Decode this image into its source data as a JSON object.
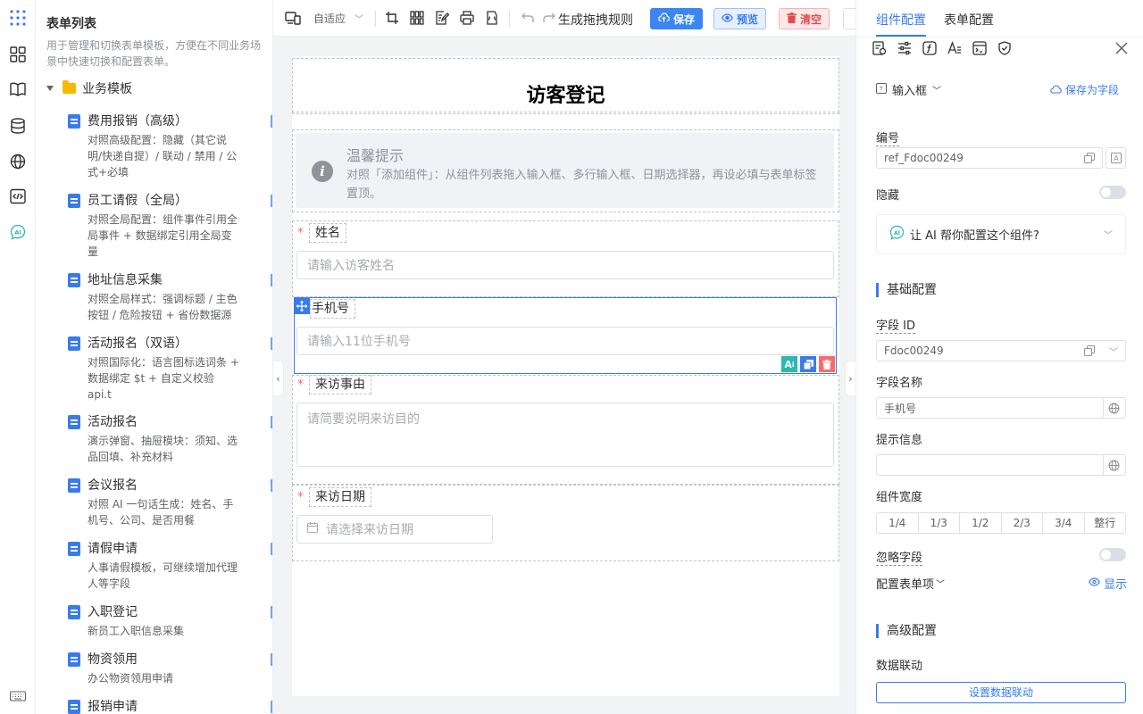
{
  "rail": {
    "icons": [
      "apps-grid-icon",
      "component-grid-icon",
      "book-icon",
      "database-icon",
      "globe-icon",
      "code-icon",
      "ai-icon",
      "keyboard-icon"
    ]
  },
  "left": {
    "title": "表单列表",
    "desc": "用于管理和切换表单模板，方便在不同业务场景中快速切换和配置表单。",
    "folder": "业务模板",
    "items": [
      {
        "title": "费用报销（高级）",
        "sub": "对照高级配置：隐藏（其它说明/快递自提）/ 联动 / 禁用 / 公式+必填"
      },
      {
        "title": "员工请假（全局）",
        "sub": "对照全局配置：组件事件引用全局事件 + 数据绑定引用全局变量"
      },
      {
        "title": "地址信息采集",
        "sub": "对照全局样式：强调标题 / 主色按钮 / 危险按钮 + 省份数据源"
      },
      {
        "title": "活动报名（双语）",
        "sub": "对照国际化：语言图标选词条 + 数据绑定 $t + 自定义校验 api.t"
      },
      {
        "title": "活动报名",
        "sub": "演示弹窗、抽屉模块：须知、选品回填、补充材料"
      },
      {
        "title": "会议报名",
        "sub": "对照 AI 一句话生成：姓名、手机号、公司、是否用餐"
      },
      {
        "title": "请假申请",
        "sub": "人事请假模板，可继续增加代理人等字段"
      },
      {
        "title": "入职登记",
        "sub": "新员工入职信息采集"
      },
      {
        "title": "物资领用",
        "sub": "办公物资领用申请"
      },
      {
        "title": "报销申请",
        "sub": ""
      }
    ]
  },
  "toolbar": {
    "device_mode": "自适应",
    "rules_label": "生成拖拽规则",
    "save_label": "保存",
    "preview_label": "预览",
    "clear_label": "清空"
  },
  "form": {
    "title": "访客登记",
    "notice_title": "温馨提示",
    "notice_desc": "对照「添加组件」：从组件列表拖入输入框、多行输入框、日期选择器，再设必填与表单标签置顶。",
    "fields": [
      {
        "label": "姓名",
        "required": true,
        "placeholder": "请输入访客姓名"
      },
      {
        "label": "手机号",
        "required": false,
        "placeholder": "请输入11位手机号"
      },
      {
        "label": "来访事由",
        "required": true,
        "placeholder": "请简要说明来访目的"
      },
      {
        "label": "来访日期",
        "required": true,
        "placeholder": "请选择来访日期"
      }
    ],
    "required_mark": "*"
  },
  "right": {
    "tab_component": "组件配置",
    "tab_form": "表单配置",
    "component_type": "输入框",
    "save_as_field": "保存为字段",
    "ref_label": "编号",
    "ref_value": "ref_Fdoc00249",
    "hidden_label": "隐藏",
    "ai_prompt": "让 AI 帮你配置这个组件?",
    "basic_section": "基础配置",
    "field_id_label": "字段 ID",
    "field_id_value": "Fdoc00249",
    "field_name_label": "字段名称",
    "field_name_value": "手机号",
    "hint_label": "提示信息",
    "hint_value": "",
    "width_label": "组件宽度",
    "width_options": [
      "1/4",
      "1/3",
      "1/2",
      "2/3",
      "3/4",
      "整行"
    ],
    "ignore_label": "忽略字段",
    "config_items_label": "配置表单项",
    "show_label": "显示",
    "advanced_section": "高级配置",
    "linkage_label": "数据联动",
    "linkage_button": "设置数据联动"
  },
  "colors": {
    "accent": "#3a7bec",
    "danger": "#e64a4a",
    "folder": "#f7b900"
  }
}
